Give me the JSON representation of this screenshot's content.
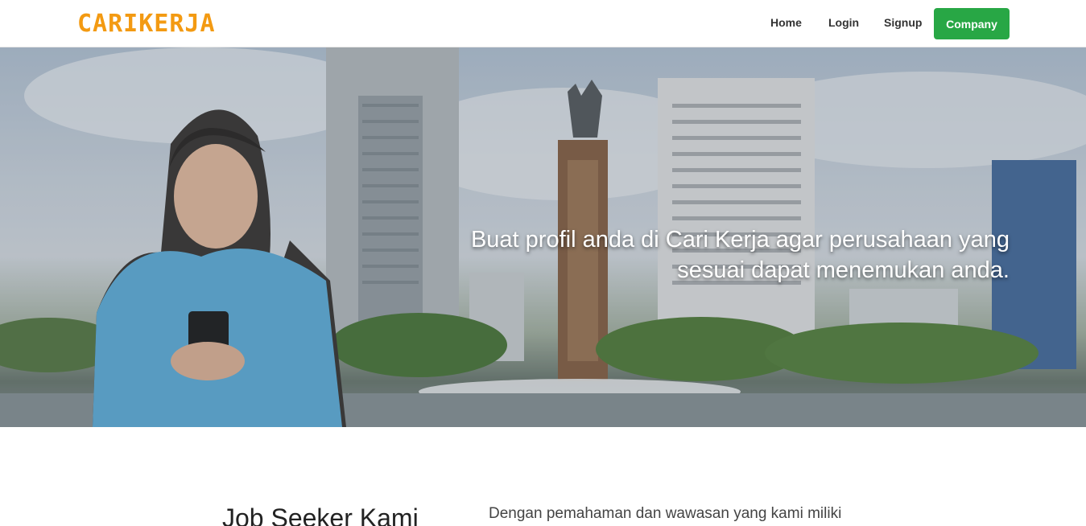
{
  "navbar": {
    "logo_text": "CARIKERJA",
    "links": {
      "home": "Home",
      "login": "Login",
      "signup": "Signup"
    },
    "company_button": "Company"
  },
  "hero": {
    "headline_line1": "Buat profil anda di Cari Kerja agar perusahaan yang",
    "headline_line2": "sesuai dapat menemukan anda."
  },
  "section": {
    "title": "Job Seeker Kami",
    "description": "Dengan pemahaman dan wawasan yang kami miliki"
  },
  "colors": {
    "brand_orange": "#f39a12",
    "company_button_green": "#28a745"
  }
}
